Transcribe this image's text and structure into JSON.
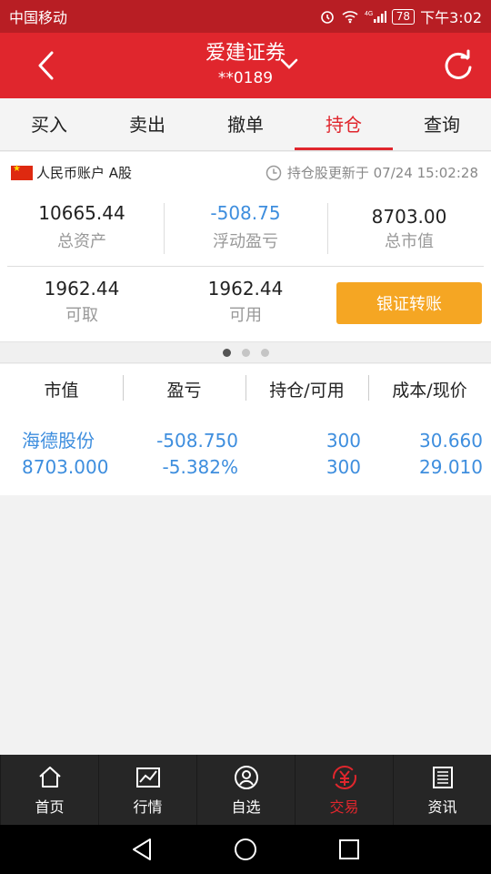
{
  "statusbar": {
    "carrier": "中国移动",
    "battery": "78",
    "time": "下午3:02"
  },
  "header": {
    "title": "爱建证券",
    "account": "**0189"
  },
  "tabs": [
    "买入",
    "卖出",
    "撤单",
    "持仓",
    "查询"
  ],
  "active_tab": "持仓",
  "account": {
    "label": "人民币账户 A股",
    "updated": "持仓股更新于 07/24 15:02:28",
    "total_assets": {
      "value": "10665.44",
      "label": "总资产"
    },
    "floating_pnl": {
      "value": "-508.75",
      "label": "浮动盈亏"
    },
    "market_value": {
      "value": "8703.00",
      "label": "总市值"
    },
    "withdrawable": {
      "value": "1962.44",
      "label": "可取"
    },
    "available": {
      "value": "1962.44",
      "label": "可用"
    },
    "transfer_button": "银证转账"
  },
  "pager": {
    "pages": 3,
    "current": 1
  },
  "table": {
    "headers": [
      "市值",
      "盈亏",
      "持仓/可用",
      "成本/现价"
    ],
    "rows": [
      {
        "name": "海德股份",
        "market_value": "8703.000",
        "pnl": "-508.750",
        "pnl_pct": "-5.382%",
        "holding": "300",
        "available": "300",
        "cost": "30.660",
        "price": "29.010"
      }
    ]
  },
  "tabbar": [
    "首页",
    "行情",
    "自选",
    "交易",
    "资讯"
  ],
  "tabbar_active": "交易",
  "colors": {
    "brand_red": "#e0262d",
    "blue": "#3e8ede",
    "orange": "#f5a623"
  }
}
